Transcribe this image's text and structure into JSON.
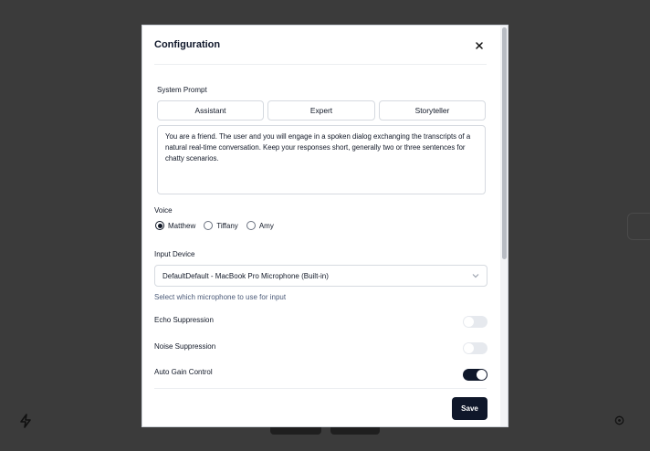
{
  "modal": {
    "title": "Configuration",
    "close_label": "×"
  },
  "system_prompt": {
    "label": "System Prompt",
    "presets": [
      "Assistant",
      "Expert",
      "Storyteller"
    ],
    "text": "You are a friend. The user and you will engage in a spoken dialog exchanging the transcripts of a natural real-time conversation. Keep your responses short, generally two or three sentences for chatty scenarios."
  },
  "voice": {
    "label": "Voice",
    "options": [
      "Matthew",
      "Tiffany",
      "Amy"
    ],
    "selected": "Matthew"
  },
  "input_device": {
    "label": "Input Device",
    "value": "DefaultDefault - MacBook Pro Microphone (Built-in)",
    "hint": "Select which microphone to use for input"
  },
  "toggles": [
    {
      "label": "Echo Suppression",
      "on": false
    },
    {
      "label": "Noise Suppression",
      "on": false
    },
    {
      "label": "Auto Gain Control",
      "on": true
    }
  ],
  "footer": {
    "save_label": "Save"
  },
  "colors": {
    "accent": "#0f172a",
    "backdrop": "#3b3b3b"
  }
}
